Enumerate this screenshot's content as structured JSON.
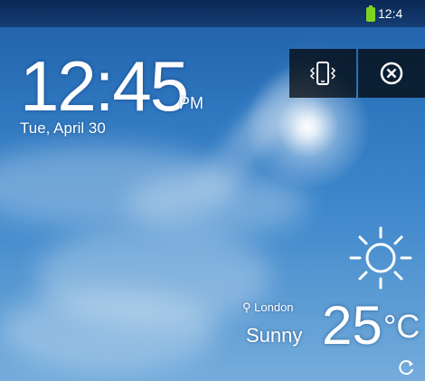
{
  "status_bar": {
    "time": "12:4",
    "battery_icon": "battery-icon",
    "battery_color": "#7ed321"
  },
  "clock": {
    "time": "12:45",
    "ampm": "PM",
    "date": "Tue, April 30"
  },
  "top_buttons": [
    {
      "icon": "vibrate-phone-icon"
    },
    {
      "icon": "close-circle-icon"
    }
  ],
  "weather": {
    "icon": "sun-icon",
    "location": "London",
    "condition": "Sunny",
    "temperature": "25",
    "unit": "°C",
    "refresh_icon": "refresh-icon"
  }
}
